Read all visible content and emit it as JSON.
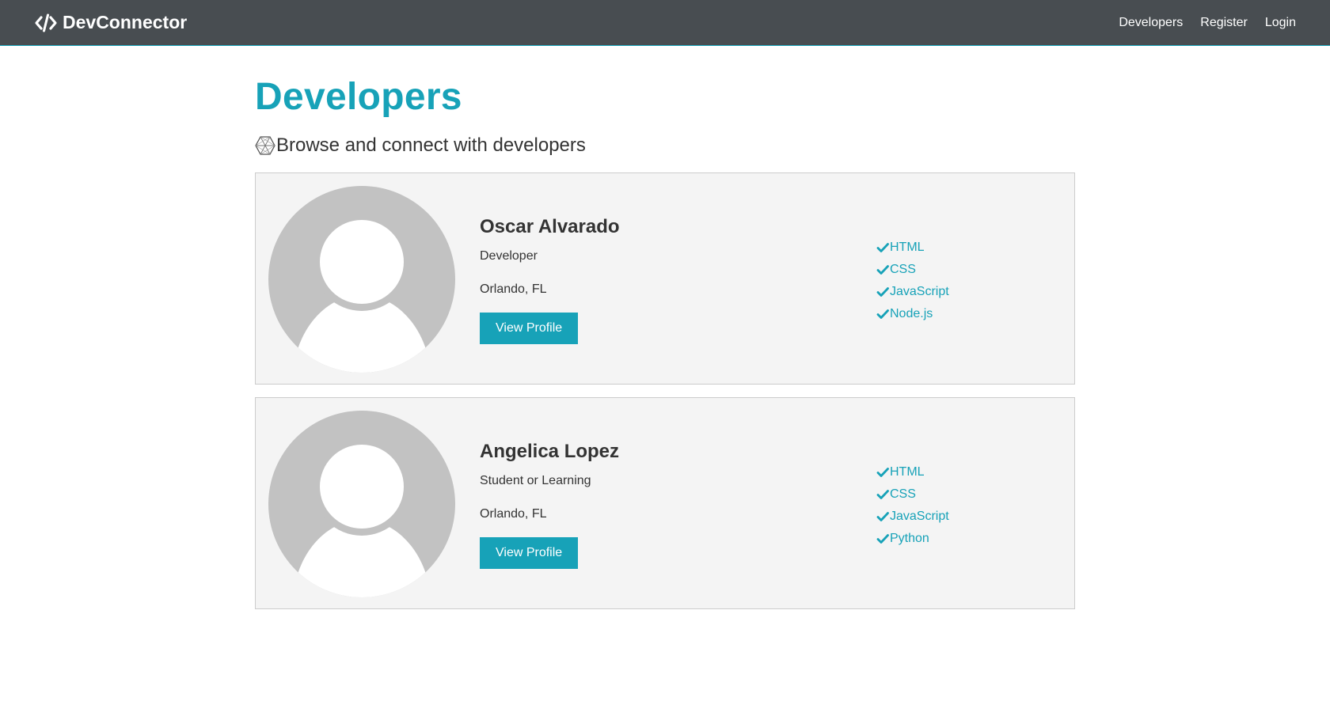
{
  "nav": {
    "brand": "DevConnector",
    "links": [
      "Developers",
      "Register",
      "Login"
    ]
  },
  "page": {
    "title": "Developers",
    "lead": "Browse and connect with developers"
  },
  "profiles": [
    {
      "name": "Oscar Alvarado",
      "status": "Developer",
      "location": "Orlando, FL",
      "button": "View Profile",
      "skills": [
        "HTML",
        "CSS",
        "JavaScript",
        "Node.js"
      ]
    },
    {
      "name": "Angelica Lopez",
      "status": "Student or Learning",
      "location": "Orlando, FL",
      "button": "View Profile",
      "skills": [
        "HTML",
        "CSS",
        "JavaScript",
        "Python"
      ]
    }
  ],
  "icons": {
    "brand": "code-icon",
    "lead": "connectdevelop-icon",
    "skill": "check-icon",
    "avatar": "default-avatar"
  },
  "colors": {
    "navbar": "#484d51",
    "primary": "#17a2b8",
    "card_bg": "#f4f4f4",
    "avatar_bg": "#c2c2c2"
  }
}
